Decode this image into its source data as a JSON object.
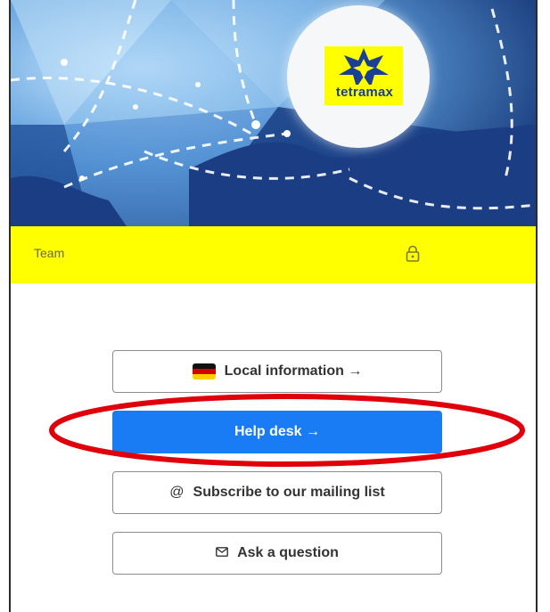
{
  "header": {
    "logo_text": "tetramax"
  },
  "teambar": {
    "label": "Team",
    "lock_icon": "lock-icon"
  },
  "buttons": {
    "local": {
      "label": "Local information →",
      "icon": "flag-de-icon"
    },
    "helpdesk": {
      "label": "Help desk →"
    },
    "subscribe": {
      "label": "Subscribe to our mailing list",
      "icon": "at-icon"
    },
    "ask": {
      "label": "Ask a question",
      "icon": "envelope-icon"
    }
  },
  "colors": {
    "accent_yellow": "#ffff00",
    "primary_blue": "#1a7cf5",
    "highlight_red": "#e0000b",
    "hero_navy": "#14306f"
  }
}
